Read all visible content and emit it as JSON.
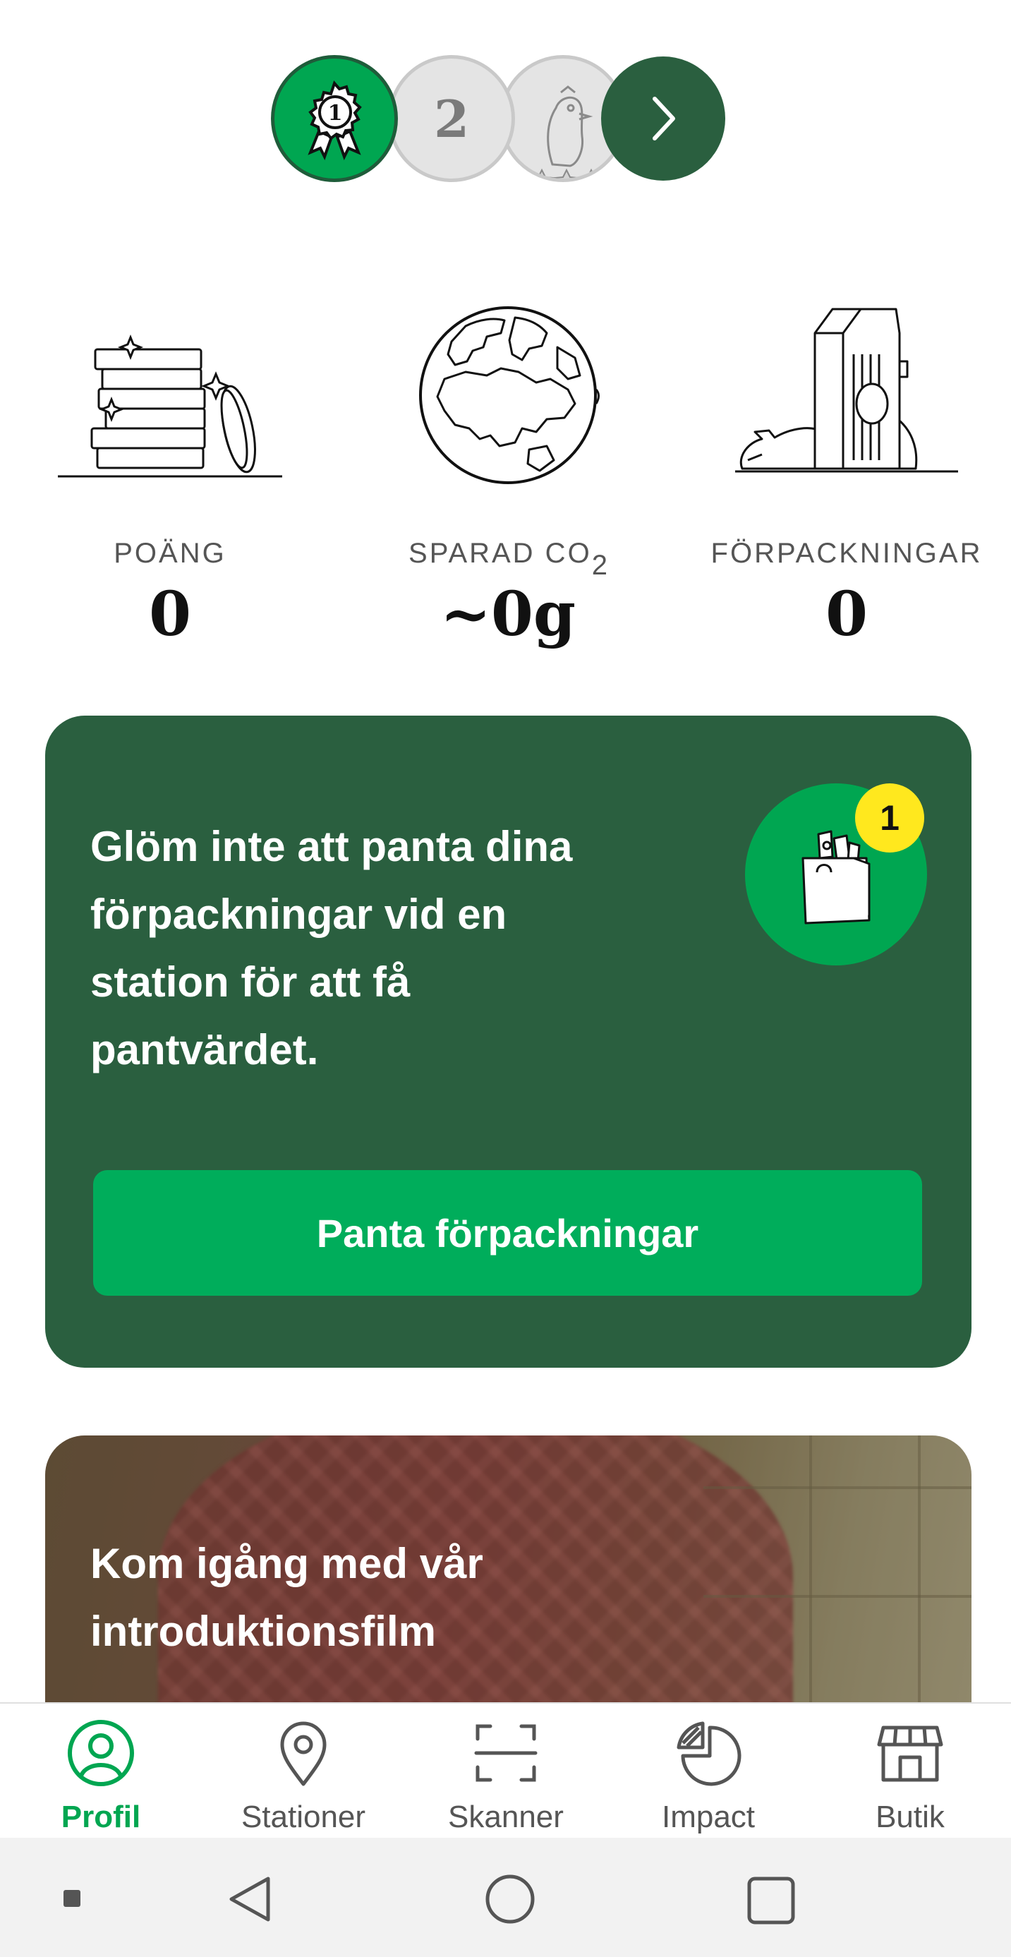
{
  "badges": {
    "first": {
      "number": "1",
      "state": "earned"
    },
    "second": {
      "number": "2",
      "state": "locked"
    },
    "third": {
      "state": "locked"
    },
    "next_icon": "chevron-right-icon"
  },
  "stats": [
    {
      "label": "POÄNG",
      "value": "0",
      "icon": "coins-stack-icon"
    },
    {
      "label": "SPARAD CO",
      "label_sub": "2",
      "value": "~0g",
      "icon": "globe-icon"
    },
    {
      "label": "FÖRPACKNINGAR",
      "value": "0",
      "icon": "packaging-icon"
    }
  ],
  "reminder_card": {
    "text": "Glöm inte att panta dina förpackningar vid en station för att få pantvärdet.",
    "badge_count": "1",
    "button_label": "Panta förpackningar",
    "icon": "shopping-bag-icon"
  },
  "intro_card": {
    "title": "Kom igång med vår introduktionsfilm"
  },
  "bottom_nav": {
    "items": [
      {
        "label": "Profil",
        "icon": "profile-icon",
        "active": true
      },
      {
        "label": "Stationer",
        "icon": "location-pin-icon",
        "active": false
      },
      {
        "label": "Skanner",
        "icon": "scanner-icon",
        "active": false
      },
      {
        "label": "Impact",
        "icon": "impact-chart-icon",
        "active": false
      },
      {
        "label": "Butik",
        "icon": "store-icon",
        "active": false
      }
    ]
  },
  "colors": {
    "brand_dark_green": "#2a5f3f",
    "brand_green": "#00a651",
    "button_green": "#00ad5b",
    "notification_yellow": "#ffe81e"
  }
}
